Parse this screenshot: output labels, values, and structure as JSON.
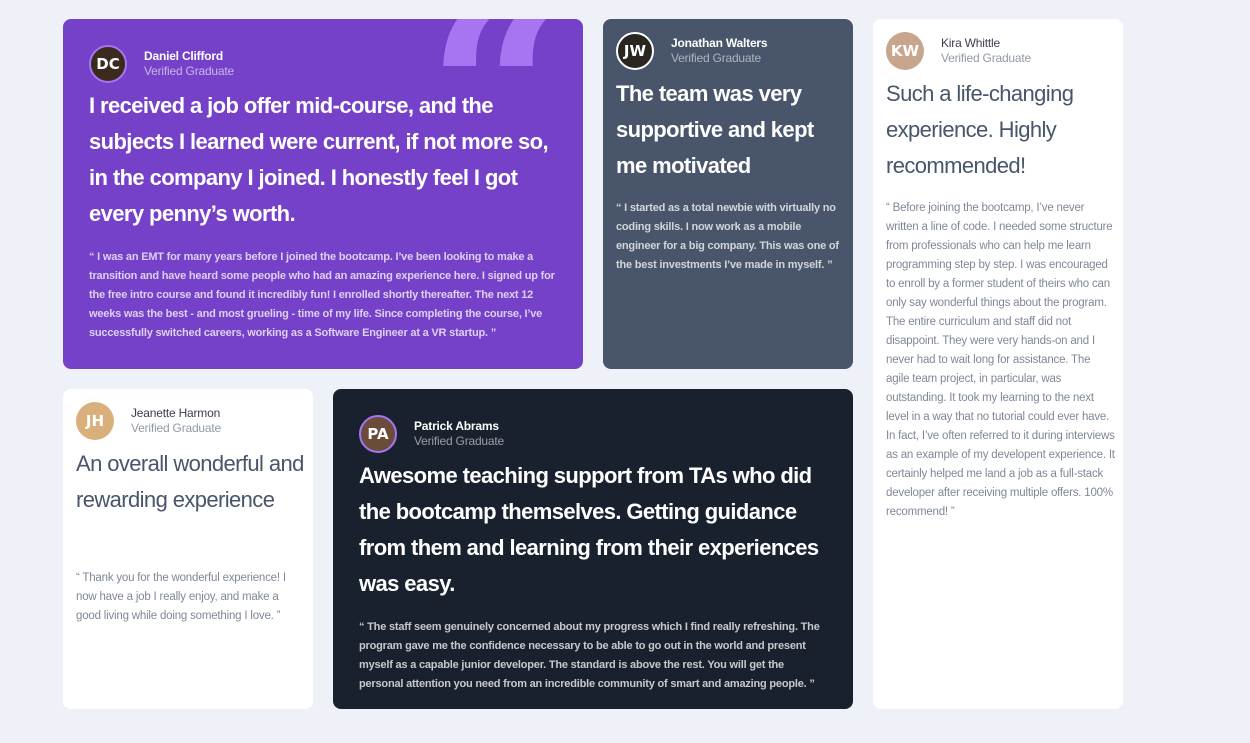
{
  "testimonials": [
    {
      "name": "Daniel Clifford",
      "status": "Verified Graduate",
      "initials": "DC",
      "headline": "I received a job offer mid-course, and the subjects I learned were current, if not more so, in the company I joined. I honestly feel I got every penny’s worth.",
      "quote": "“ I was an EMT for many years before I joined the bootcamp. I’ve been looking to make a transition and have heard some people who had an amazing experience here. I signed up for the free intro course and found it incredibly fun! I enrolled shortly thereafter. The next 12 weeks was the best - and most grueling - time of my life. Since completing the course, I’ve successfully switched careers, working as a Software Engineer at a VR startup. ”"
    },
    {
      "name": "Jonathan Walters",
      "status": "Verified Graduate",
      "initials": "JW",
      "headline": "The team was very supportive and kept me motivated",
      "quote": "“ I started as a total newbie with virtually no coding skills. I now work as a mobile engineer for a big company. This was one of the best investments I’ve made in myself. ”"
    },
    {
      "name": "Kira Whittle",
      "status": "Verified Graduate",
      "initials": "KW",
      "headline": "Such a life-changing experience. Highly recommended!",
      "quote": "“ Before joining the bootcamp, I’ve never written a line of code. I needed some structure from professionals who can help me learn programming step by step. I was encouraged to enroll by a former student of theirs who can only say wonderful things about the program. The entire curriculum and staff did not disappoint. They were very hands-on and I never had to wait long for assistance. The agile team project, in particular, was outstanding. It took my learning to the next level in a way that no tutorial could ever have. In fact, I’ve often referred to it during interviews as an example of my developent experience. It certainly helped me land a job as a full-stack developer after receiving multiple offers. 100% recommend! ”"
    },
    {
      "name": "Jeanette Harmon",
      "status": "Verified Graduate",
      "initials": "JH",
      "headline": "An overall wonderful and rewarding experience",
      "quote": "“ Thank you for the wonderful experience! I now have a job I really enjoy, and make a good living while doing something I love. ”"
    },
    {
      "name": "Patrick Abrams",
      "status": "Verified Graduate",
      "initials": "PA",
      "headline": "Awesome teaching support from TAs who did the bootcamp themselves. Getting guidance from them and learning from their experiences was easy.",
      "quote": "“ The staff seem genuinely concerned about my progress which I find really refreshing. The program gave me the confidence necessary to be able to go out in the world and present myself as a capable junior developer. The standard is above the rest. You will get the personal attention you need from an incredible community of smart and amazing people. ”"
    }
  ],
  "decor": {
    "quote_glyph": "“"
  },
  "colors": {
    "page_bg": "#eef1f8",
    "moderate_violet": "#7541c8",
    "light_violet": "#a775f1",
    "grayish_blue": "#48556a",
    "very_dark_blackish_blue": "#19212e",
    "white": "#ffffff"
  }
}
